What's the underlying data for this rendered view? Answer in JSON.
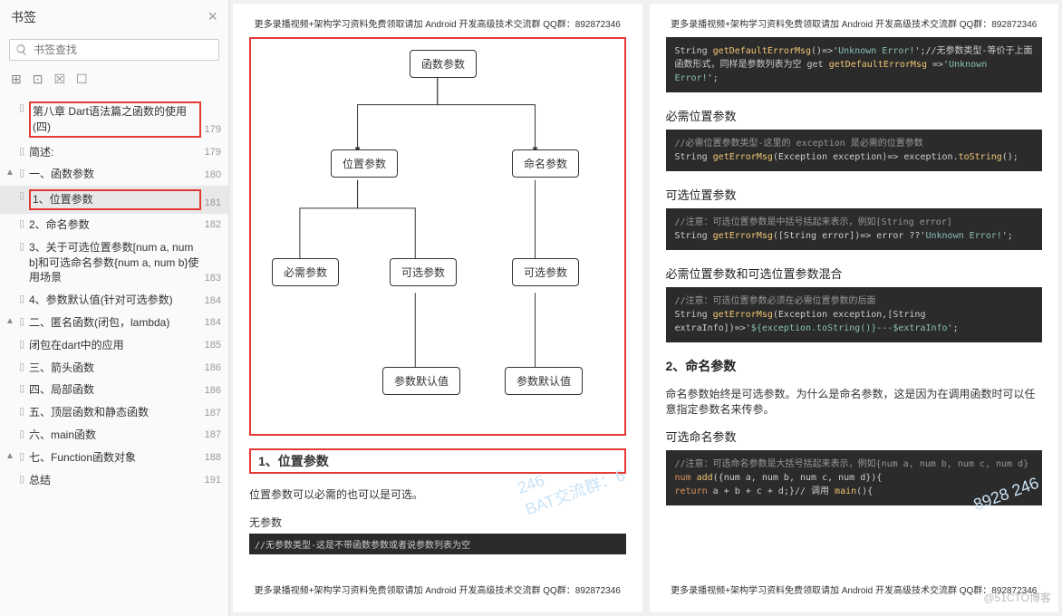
{
  "sidebar": {
    "title": "书签",
    "search_placeholder": "书签查找",
    "tree": [
      {
        "lvl": 1,
        "tw": "",
        "label": "第八章 Dart语法篇之函数的使用(四)",
        "page": "179",
        "red": true
      },
      {
        "lvl": 2,
        "tw": "",
        "label": "简述:",
        "page": "179"
      },
      {
        "lvl": 2,
        "tw": "▲",
        "label": "一、函数参数",
        "page": "180"
      },
      {
        "lvl": 3,
        "tw": "",
        "label": "1、位置参数",
        "page": "181",
        "red": true,
        "sel": true
      },
      {
        "lvl": 3,
        "tw": "",
        "label": "2、命名参数",
        "page": "182"
      },
      {
        "lvl": 3,
        "tw": "",
        "label": "3、关于可选位置参数[num a, num b]和可选命名参数{num a, num b}使用场景",
        "page": "183"
      },
      {
        "lvl": 3,
        "tw": "",
        "label": "4、参数默认值(针对可选参数)",
        "page": "184"
      },
      {
        "lvl": 2,
        "tw": "▲",
        "label": "二、匿名函数(闭包，lambda)",
        "page": "184"
      },
      {
        "lvl": 3,
        "tw": "",
        "label": "闭包在dart中的应用",
        "page": "185"
      },
      {
        "lvl": 2,
        "tw": "",
        "label": "三、箭头函数",
        "page": "186"
      },
      {
        "lvl": 2,
        "tw": "",
        "label": "四、局部函数",
        "page": "186"
      },
      {
        "lvl": 2,
        "tw": "",
        "label": "五、顶层函数和静态函数",
        "page": "187"
      },
      {
        "lvl": 2,
        "tw": "",
        "label": "六、main函数",
        "page": "187"
      },
      {
        "lvl": 2,
        "tw": "▲",
        "label": "七、Function函数对象",
        "page": "188"
      },
      {
        "lvl": 3,
        "tw": "",
        "label": "总结",
        "page": "191"
      }
    ]
  },
  "header_note": "更多录播视频+架构学习资料免费领取请加 Android 开发高级技术交流群  QQ群：892872346",
  "diagram": {
    "n_root": "函数参数",
    "n_pos": "位置参数",
    "n_named": "命名参数",
    "n_req": "必需参数",
    "n_opt": "可选参数",
    "n_opt2": "可选参数",
    "n_def1": "参数默认值",
    "n_def2": "参数默认值"
  },
  "page1": {
    "h1": "1、位置参数",
    "p1": "位置参数可以必需的也可以是可选。",
    "sub1": "无参数",
    "bar1": "//无参数类型-这是不带函数参数或者说参数列表为空"
  },
  "page2": {
    "code1_a": "String ",
    "code1_b": "getDefaultErrorMsg",
    "code1_c": "()=>'",
    "code1_d": "Unknown Error!",
    "code1_e": "';//无参数类型-等价于上面函数形式，同样是参数列表为空 get ",
    "code1_f": "getDefaultErrorMsg",
    "code1_g": " =>'",
    "code1_h": "Unknown Error!",
    "code1_i": "';",
    "h_req": "必需位置参数",
    "c_req1": "//必需位置参数类型-这里的 exception 是必需的位置参数",
    "c_req2a": "String ",
    "c_req2b": "getErrorMsg",
    "c_req2c": "(Exception exception)=> exception.",
    "c_req2d": "toString",
    "c_req2e": "();",
    "h_opt": "可选位置参数",
    "c_opt1": "//注意：可选位置参数是中括号括起来表示，例如[String error]",
    "c_opt2a": "String ",
    "c_opt2b": "getErrorMsg",
    "c_opt2c": "([String error])=> error ??'",
    "c_opt2d": "Unknown Error!",
    "c_opt2e": "';",
    "h_mix": "必需位置参数和可选位置参数混合",
    "c_mix1": "//注意：可选位置参数必须在必需位置参数的后面",
    "c_mix2a": "String ",
    "c_mix2b": "getErrorMsg",
    "c_mix2c": "(Exception exception,[String extraInfo])=>'",
    "c_mix2d": "${exception.toString()}---$extraInfo",
    "c_mix2e": "';",
    "h_named": "2、命名参数",
    "p_named": "命名参数始终是可选参数。为什么是命名参数，这是因为在调用函数时可以任意指定参数名来传参。",
    "h_optnamed": "可选命名参数",
    "c_on1": "//注意：可选命名参数是大括号括起来表示，例如{num a, num b, num c, num d}",
    "c_on2a": "num ",
    "c_on2b": "add",
    "c_on2c": "({num a, num b, num c, num d}){",
    "c_on3a": "return",
    "c_on3b": " a + b + c + d;}// 调用 ",
    "c_on3c": "main",
    "c_on3d": "(){"
  },
  "watermark": "@51CTO博客",
  "wm_group": "8928 246"
}
